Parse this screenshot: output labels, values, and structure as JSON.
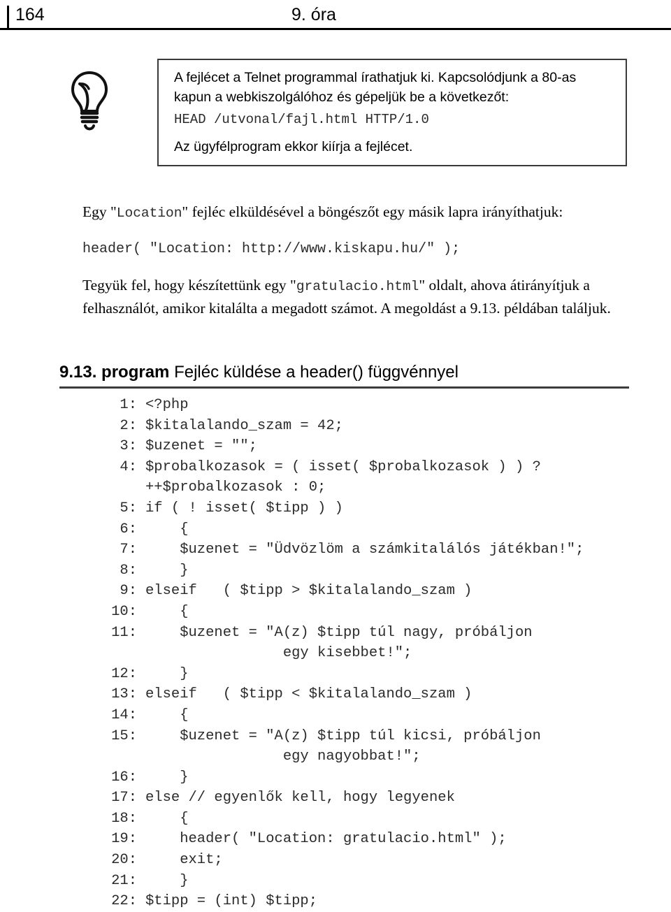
{
  "header": {
    "page_number": "164",
    "title": "9. óra"
  },
  "tip": {
    "icon": "lightbulb-icon",
    "paragraph_1": "A fejlécet a Telnet programmal írathatjuk ki. Kapcsolódjunk a 80-as kapun a webkiszolgálóhoz és gépeljük be a következőt:",
    "code": "HEAD /utvonal/fajl.html HTTP/1.0",
    "paragraph_2": "Az ügyfélprogram ekkor kiírja a fejlécet."
  },
  "body": {
    "paragraph_1_before": "Egy \"",
    "paragraph_1_mono": "Location",
    "paragraph_1_after": "\" fejléc elküldésével a böngészőt egy másik lapra irányíthatjuk:",
    "code_line": "header( \"Location: http://www.kiskapu.hu/\" );",
    "paragraph_2_before": "Tegyük fel, hogy készítettünk egy \"",
    "paragraph_2_mono": "gratulacio.html",
    "paragraph_2_after": "\" oldalt, ahova átirányítjuk a felhasználót, amikor kitalálta a megadott számot. A megoldást a 9.13. példában találjuk."
  },
  "listing": {
    "number": "9.13. program",
    "caption": "Fejléc küldése a header() függvénnyel",
    "lines": [
      {
        "n": "1:",
        "code": "<?php"
      },
      {
        "n": "2:",
        "code": "$kitalalando_szam = 42;"
      },
      {
        "n": "3:",
        "code": "$uzenet = \"\";"
      },
      {
        "n": "4:",
        "code": "$probalkozasok = ( isset( $probalkozasok ) ) ?"
      },
      {
        "n": "",
        "code": "++$probalkozasok : 0;",
        "cont": true
      },
      {
        "n": "5:",
        "code": "if ( ! isset( $tipp ) )"
      },
      {
        "n": "6:",
        "code": "    {"
      },
      {
        "n": "7:",
        "code": "    $uzenet = \"Üdvözlöm a számkitalálós játékban!\";"
      },
      {
        "n": "8:",
        "code": "    }"
      },
      {
        "n": "9:",
        "code": "elseif   ( $tipp > $kitalalando_szam )"
      },
      {
        "n": "10:",
        "code": "    {"
      },
      {
        "n": "11:",
        "code": "    $uzenet = \"A(z) $tipp túl nagy, próbáljon"
      },
      {
        "n": "",
        "code": "                egy kisebbet!\";",
        "cont": true
      },
      {
        "n": "12:",
        "code": "    }"
      },
      {
        "n": "13:",
        "code": "elseif   ( $tipp < $kitalalando_szam )"
      },
      {
        "n": "14:",
        "code": "    {"
      },
      {
        "n": "15:",
        "code": "    $uzenet = \"A(z) $tipp túl kicsi, próbáljon"
      },
      {
        "n": "",
        "code": "                egy nagyobbat!\";",
        "cont": true
      },
      {
        "n": "16:",
        "code": "    }"
      },
      {
        "n": "17:",
        "code": "else // egyenlők kell, hogy legyenek"
      },
      {
        "n": "18:",
        "code": "    {"
      },
      {
        "n": "19:",
        "code": "    header( \"Location: gratulacio.html\" );"
      },
      {
        "n": "20:",
        "code": "    exit;"
      },
      {
        "n": "21:",
        "code": "    }"
      },
      {
        "n": "22:",
        "code": "$tipp = (int) $tipp;"
      }
    ]
  }
}
